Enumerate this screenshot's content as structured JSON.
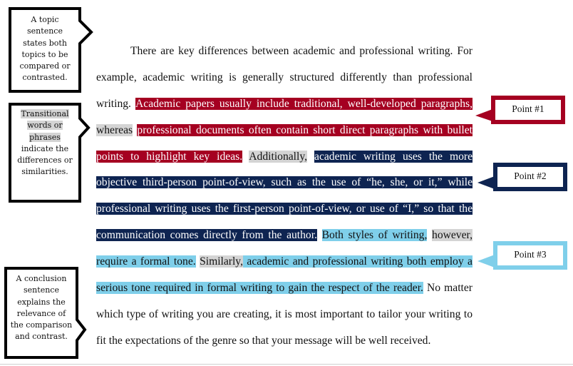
{
  "colors": {
    "point1": "#A50021",
    "point2": "#0E2451",
    "point3": "#7FCFEA",
    "transition": "#D4D4D4"
  },
  "callouts": {
    "topic": "A topic sentence states both topics to be compared or contrasted.",
    "transitional": {
      "highlighted": [
        "Transitional",
        "words or",
        "phrases"
      ],
      "rest": "indicate the differences or similarities."
    },
    "conclusion": "A conclusion sentence explains the relevance of the comparison and contrast.",
    "point1": "Point #1",
    "point2": "Point #2",
    "point3": "Point #3"
  },
  "paragraph_lines": [
    [
      {
        "t": "There are key differences between academic and professional writing. For",
        "s": ""
      }
    ],
    [
      {
        "t": "example, academic writing is generally structured differently than professional",
        "s": ""
      }
    ],
    [
      {
        "t": "writing. ",
        "s": ""
      },
      {
        "t": "Academic papers usually include traditional, well-developed paragraphs,",
        "s": "r"
      }
    ],
    [
      {
        "t": "whereas",
        "s": "g"
      },
      {
        "t": " ",
        "s": ""
      },
      {
        "t": "professional documents often contain short direct paragraphs with bullet",
        "s": "r"
      }
    ],
    [
      {
        "t": "points to highlight key ideas.",
        "s": "r"
      },
      {
        "t": " ",
        "s": ""
      },
      {
        "t": "Additionally,",
        "s": "g"
      },
      {
        "t": " ",
        "s": ""
      },
      {
        "t": "academic writing uses the more",
        "s": "n"
      }
    ],
    [
      {
        "t": "objective third-person point-of-view, such as the use of “he, she, or it,” while",
        "s": "n"
      }
    ],
    [
      {
        "t": "professional writing uses the first-person point-of-view, or use of “I,” so that the",
        "s": "n"
      }
    ],
    [
      {
        "t": "communication comes directly from the author.",
        "s": "n"
      },
      {
        "t": " ",
        "s": ""
      },
      {
        "t": "Both styles of writing,",
        "s": "b"
      },
      {
        "t": " ",
        "s": ""
      },
      {
        "t": "however,",
        "s": "g"
      }
    ],
    [
      {
        "t": "require a formal tone.",
        "s": "b"
      },
      {
        "t": " ",
        "s": ""
      },
      {
        "t": "Similarly,",
        "s": "g"
      },
      {
        "t": " academic and professional writing both employ a",
        "s": "b"
      }
    ],
    [
      {
        "t": "serious tone required in formal writing to gain the respect of the reader.",
        "s": "b"
      },
      {
        "t": " No matter",
        "s": ""
      }
    ],
    [
      {
        "t": "which type of writing you are creating, it is most important to tailor your writing to",
        "s": ""
      }
    ],
    [
      {
        "t": "fit the expectations of the genre so that your message will be well received.",
        "s": ""
      }
    ]
  ]
}
